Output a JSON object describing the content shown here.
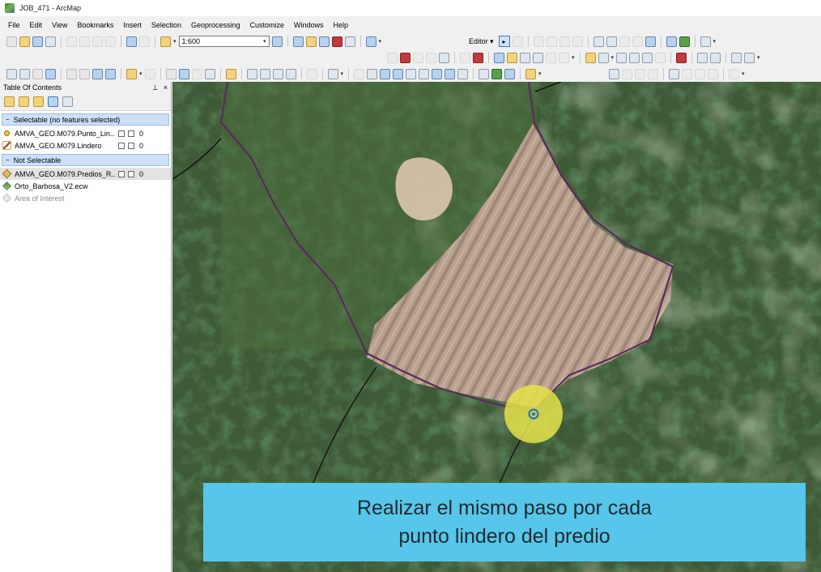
{
  "window": {
    "title": "JOB_471 - ArcMap"
  },
  "menu": [
    "File",
    "Edit",
    "View",
    "Bookmarks",
    "Insert",
    "Selection",
    "Geoprocessing",
    "Customize",
    "Windows",
    "Help"
  ],
  "toolbar": {
    "scale": "1:600",
    "editor_label": "Editor"
  },
  "toc": {
    "title": "Table Of Contents",
    "pin": "p",
    "close": "×",
    "groups": [
      {
        "label": "Selectable (no features selected)",
        "layers": [
          {
            "name": "AMVA_GEO.M079.Punto_Lin...",
            "count": "0",
            "icon": "point-layer-icon"
          },
          {
            "name": "AMVA_GEO.M079.Lindero",
            "count": "0",
            "icon": "line-layer-icon"
          }
        ]
      },
      {
        "label": "Not Selectable",
        "layers": [
          {
            "name": "AMVA_GEO.M079.Predios_R...",
            "count": "0",
            "icon": "polygon-layer-icon"
          }
        ]
      }
    ],
    "other_layers": [
      "Orto_Barbosa_V2.ecw",
      "Area of Interest"
    ]
  },
  "caption": {
    "line1": "Realizar el mismo paso por cada",
    "line2": "punto lindero del predio"
  },
  "colors": {
    "caption_bg": "#56c6ea",
    "highlight": "#e5e24a",
    "boundary": "#5a2b5c",
    "group_bg": "#cde0f6"
  }
}
